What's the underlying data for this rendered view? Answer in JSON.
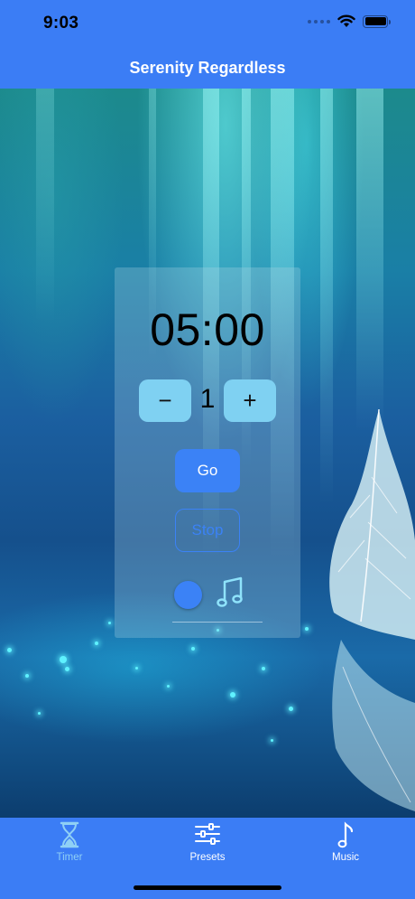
{
  "status_bar": {
    "time": "9:03"
  },
  "nav": {
    "title": "Serenity Regardless"
  },
  "timer": {
    "display": "05:00"
  },
  "stepper": {
    "decrement_label": "−",
    "value": "1",
    "increment_label": "+"
  },
  "controls": {
    "go_label": "Go",
    "stop_label": "Stop"
  },
  "sound": {
    "toggle_on": true,
    "icon": "music-note-icon"
  },
  "colors": {
    "accent": "#3b82f6",
    "bar": "#3b7df5",
    "stepper_button": "#7fd1f2",
    "active_tab": "#8fd0f5"
  },
  "tabs": [
    {
      "label": "Timer",
      "icon": "hourglass-icon",
      "active": true
    },
    {
      "label": "Presets",
      "icon": "sliders-icon",
      "active": false
    },
    {
      "label": "Music",
      "icon": "music-note-icon",
      "active": false
    }
  ]
}
